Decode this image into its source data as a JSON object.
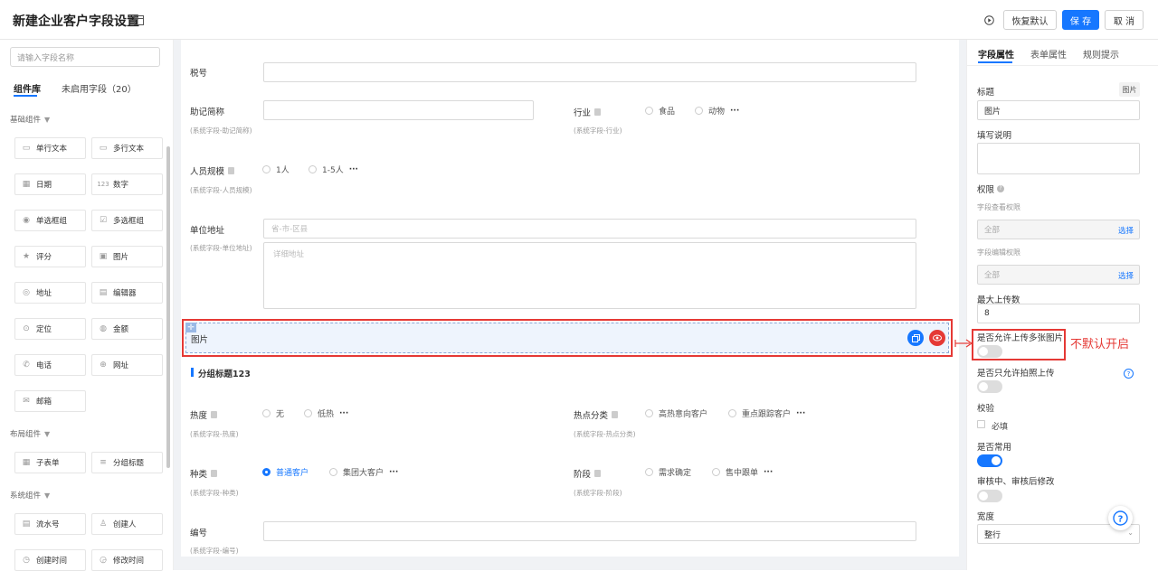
{
  "header": {
    "title": "新建企业客户字段设置",
    "restore_label": "恢复默认",
    "save_label": "保 存",
    "cancel_label": "取 消"
  },
  "sidebar": {
    "search_placeholder": "请输入字段名称",
    "tabs": [
      "组件库",
      "未启用字段（20）"
    ],
    "basic_section": "基础组件",
    "basic_items": [
      "单行文本",
      "多行文本",
      "日期",
      "数字",
      "单选框组",
      "多选框组",
      "评分",
      "图片",
      "地址",
      "编辑器",
      "定位",
      "金额",
      "电话",
      "网址",
      "邮箱"
    ],
    "layout_section": "布局组件",
    "layout_items": [
      "子表单",
      "分组标题"
    ],
    "system_section": "系统组件",
    "system_items": [
      "流水号",
      "创建人",
      "创建时间",
      "修改时间"
    ]
  },
  "form": {
    "tax_label": "税号",
    "mnemonic_label": "助记简称",
    "mnemonic_sub": "(系统字段-助记简称)",
    "industry_label": "行业",
    "industry_sub": "(系统字段-行业)",
    "industry_options": [
      "食品",
      "动物"
    ],
    "staff_label": "人员规模",
    "staff_sub": "(系统字段-人员规模)",
    "staff_options": [
      "1人",
      "1-5人"
    ],
    "address_label": "单位地址",
    "address_sub": "(系统字段-单位地址)",
    "address_region_placeholder": "省-市-区县",
    "address_detail_placeholder": "详细地址",
    "image_label": "图片",
    "group_title": "分组标题123",
    "heat_label": "热度",
    "heat_sub": "(系统字段-热度)",
    "heat_options": [
      "无",
      "低热"
    ],
    "hotcat_label": "热点分类",
    "hotcat_sub": "(系统字段-热点分类)",
    "hotcat_options": [
      "高热意向客户",
      "重点跟踪客户"
    ],
    "kind_label": "种类",
    "kind_sub": "(系统字段-种类)",
    "kind_options": [
      "普通客户",
      "集团大客户"
    ],
    "stage_label": "阶段",
    "stage_sub": "(系统字段-阶段)",
    "stage_options": [
      "需求确定",
      "售中跟单"
    ],
    "number_label": "编号",
    "number_sub": "(系统字段-编号)",
    "more": "···",
    "annotation": "不默认开启"
  },
  "props": {
    "tabs": [
      "字段属性",
      "表单属性",
      "规则提示"
    ],
    "title_label": "标题",
    "type_badge": "图片",
    "title_value": "图片",
    "desc_label": "填写说明",
    "perm_label": "权限",
    "view_perm_label": "字段查看权限",
    "view_perm_value": "全部",
    "select_label": "选择",
    "edit_perm_label": "字段编辑权限",
    "edit_perm_value": "全部",
    "max_upload_label": "最大上传数",
    "max_upload_value": "8",
    "allow_multi_label": "是否允许上传多张图片",
    "allow_photo_label": "是否只允许拍照上传",
    "validate_label": "校验",
    "required_label": "必填",
    "common_label": "是否常用",
    "review_label": "审核中、审核后修改",
    "width_label": "宽度",
    "width_value": "整行"
  },
  "colors": {
    "primary": "#1677ff",
    "annotation_red": "#e53935",
    "selected_bg": "#eef4fd"
  }
}
